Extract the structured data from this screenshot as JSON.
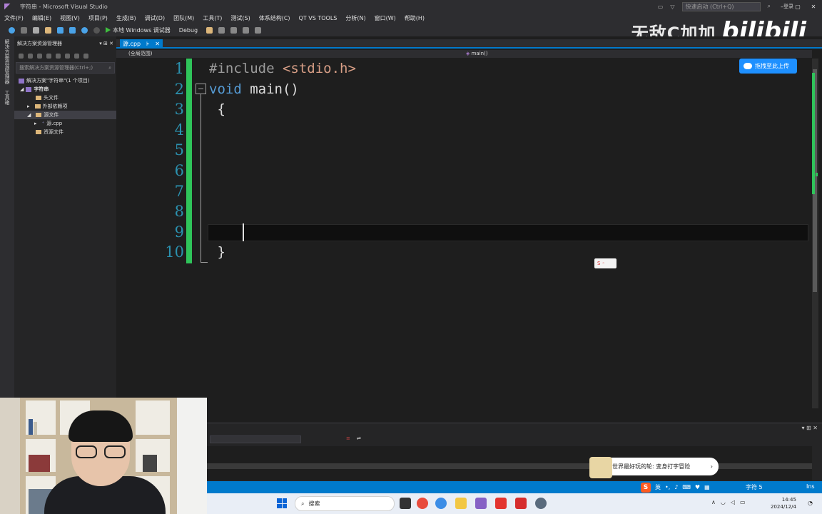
{
  "window": {
    "title": "字符串 - Microsoft Visual Studio",
    "quick_launch_placeholder": "快速启动 (Ctrl+Q)",
    "login": "登录"
  },
  "menu": [
    "文件(F)",
    "编辑(E)",
    "视图(V)",
    "项目(P)",
    "生成(B)",
    "调试(D)",
    "团队(M)",
    "工具(T)",
    "测试(S)",
    "体系结构(C)",
    "QT VS TOOLS",
    "分析(N)",
    "窗口(W)",
    "帮助(H)"
  ],
  "toolbar": {
    "run_label": "本地 Windows 调试器",
    "config": "Debug"
  },
  "watermark": {
    "channel": "无敌C加加",
    "logo": "bilibili"
  },
  "vertical_tabs": [
    "解决方案资源管理器",
    "工具箱"
  ],
  "solution_explorer": {
    "title": "解决方案资源管理器",
    "search_placeholder": "搜索解决方案资源管理器(Ctrl+;)",
    "tree": [
      {
        "label": "解决方案\"字符串\"(1 个项目)",
        "level": 0
      },
      {
        "label": "字符串",
        "level": 1
      },
      {
        "label": "头文件",
        "level": 2
      },
      {
        "label": "外部依赖项",
        "level": 2
      },
      {
        "label": "源文件",
        "level": 2
      },
      {
        "label": "源.cpp",
        "level": 3
      },
      {
        "label": "资源文件",
        "level": 2
      }
    ]
  },
  "editor": {
    "tab_name": "源.cpp",
    "scope_left": "(全局范围)",
    "scope_right": "main()",
    "line_numbers": [
      "1",
      "2",
      "3",
      "4",
      "5",
      "6",
      "7",
      "8",
      "9",
      "10"
    ],
    "code": {
      "l1_directive": "#include",
      "l1_header": " <stdio.h>",
      "l2_keyword": "void",
      "l2_rest": " main()",
      "l3": " {",
      "l10": " }"
    },
    "cursor_line": 9
  },
  "upload_button": "拖拽至此上传",
  "ime_popup": "世界最好玩的轮: 变身打字冒险",
  "status": {
    "char": "字符 5",
    "mode": "Ins",
    "ime_lang": "英"
  },
  "taskbar": {
    "search_placeholder": "搜索",
    "time": "14:45",
    "date": "2024/12/4"
  },
  "colors": {
    "accent": "#007acc",
    "change_bar": "#2fc45a",
    "keyword": "#569cd6",
    "line_number": "#2b91af"
  }
}
